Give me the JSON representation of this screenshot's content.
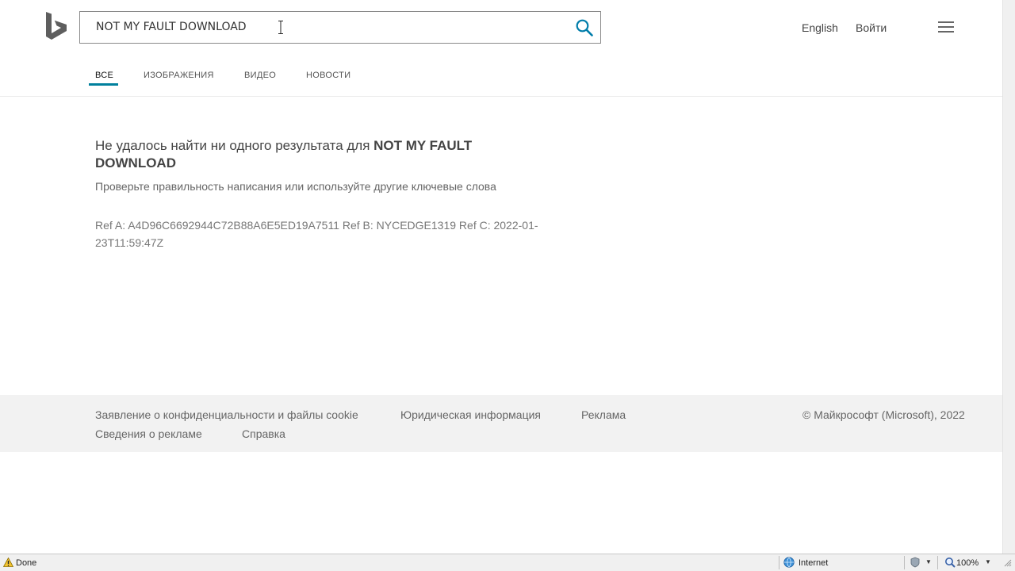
{
  "search": {
    "query": "NOT MY FAULT DOWNLOAD"
  },
  "header": {
    "language": "English",
    "signin": "Войти"
  },
  "tabs": [
    {
      "label": "ВСЕ"
    },
    {
      "label": "ИЗОБРАЖЕНИЯ"
    },
    {
      "label": "ВИДЕО"
    },
    {
      "label": "НОВОСТИ"
    }
  ],
  "message": {
    "title_prefix": "Не удалось найти ни одного результата для ",
    "title_query": "NOT MY FAULT DOWNLOAD",
    "subtitle": "Проверьте правильность написания или используйте другие ключевые слова",
    "ref": "Ref A: A4D96C6692944C72B88A6E5ED19A7511 Ref B: NYCEDGE1319 Ref C: 2022-01-23T11:59:47Z"
  },
  "footer": {
    "privacy": "Заявление о конфиденциальности и файлы cookie",
    "legal": "Юридическая информация",
    "ads": "Реклама",
    "about_ads": "Сведения о рекламе",
    "help": "Справка",
    "copyright": "© Майкрософт (Microsoft), 2022"
  },
  "statusbar": {
    "status": "Done",
    "zone": "Internet",
    "zoom": "100%"
  },
  "colors": {
    "accent": "#00809d",
    "logo": "#5e5e5e",
    "footer_bg": "#f2f2f2"
  }
}
